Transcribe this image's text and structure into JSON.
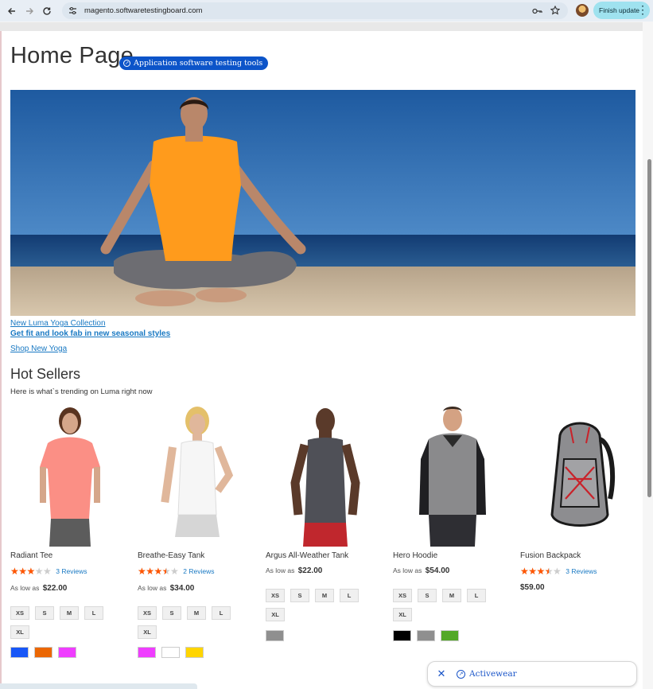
{
  "browser": {
    "url": "magento.softwaretestingboard.com",
    "finish_update_label": "Finish update",
    "icons": [
      "back-arrow-icon",
      "forward-arrow-icon",
      "reload-icon",
      "site-info-icon",
      "password-key-icon",
      "bookmark-star-icon",
      "profile-avatar-icon",
      "kebab-menu-icon"
    ]
  },
  "page": {
    "title": "Home Page",
    "ad_badge": "Application software testing tools"
  },
  "promo": {
    "line1": "New Luma Yoga Collection",
    "line2": "Get fit and look fab in new seasonal styles",
    "cta": "Shop New Yoga"
  },
  "hot_sellers": {
    "title": "Hot Sellers",
    "subtitle": "Here is what`s trending on Luma right now"
  },
  "products": [
    {
      "name": "Radiant Tee",
      "rating": 0.6,
      "reviews": "3 Reviews",
      "price_prefix": "As low as",
      "price": "$22.00",
      "sizes": [
        "XS",
        "S",
        "M",
        "L",
        "XL"
      ],
      "colors": [
        "#1857f7",
        "#eb6703",
        "#ef3dff"
      ]
    },
    {
      "name": "Breathe-Easy Tank",
      "rating": 0.7,
      "reviews": "2 Reviews",
      "price_prefix": "As low as",
      "price": "$34.00",
      "sizes": [
        "XS",
        "S",
        "M",
        "L",
        "XL"
      ],
      "colors": [
        "#ef3dff",
        "#ffffff",
        "#ffd500"
      ]
    },
    {
      "name": "Argus All-Weather Tank",
      "rating": null,
      "reviews": "",
      "price_prefix": "As low as",
      "price": "$22.00",
      "sizes": [
        "XS",
        "S",
        "M",
        "L",
        "XL"
      ],
      "colors": [
        "#8f8f8f"
      ]
    },
    {
      "name": "Hero Hoodie",
      "rating": null,
      "reviews": "",
      "price_prefix": "As low as",
      "price": "$54.00",
      "sizes": [
        "XS",
        "S",
        "M",
        "L",
        "XL"
      ],
      "colors": [
        "#000000",
        "#8f8f8f",
        "#53a828"
      ]
    },
    {
      "name": "Fusion Backpack",
      "rating": 0.7,
      "reviews": "3 Reviews",
      "price_prefix": "",
      "price": "$59.00",
      "sizes": [],
      "colors": []
    }
  ],
  "popup": {
    "label": "Activewear"
  }
}
